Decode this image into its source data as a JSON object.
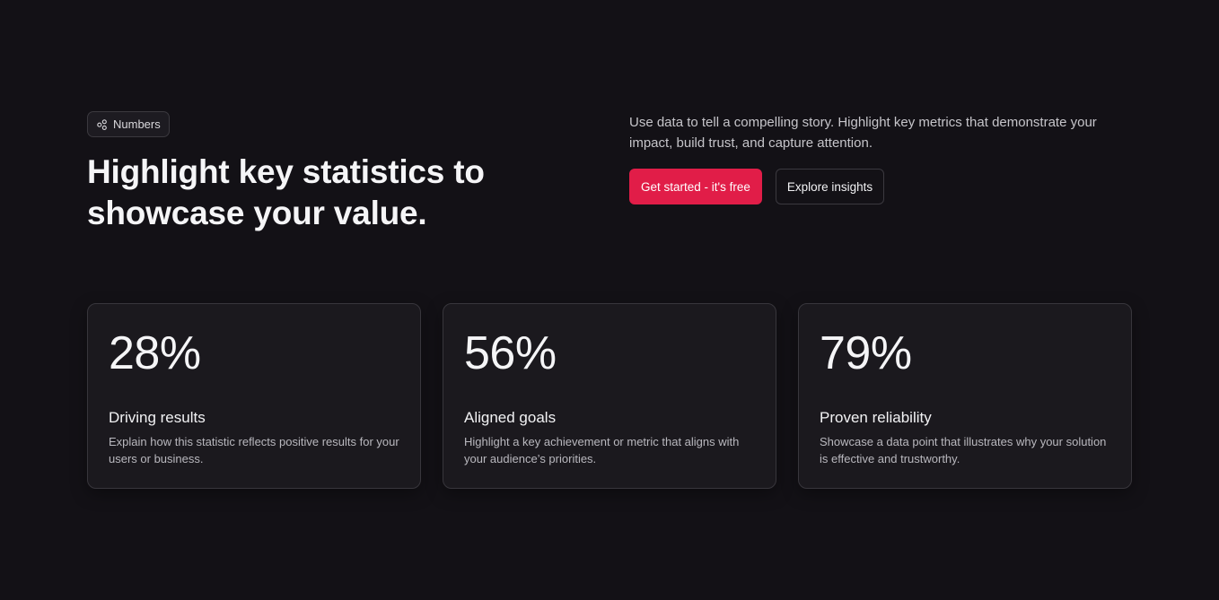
{
  "colors": {
    "background": "#131116",
    "accent": "#e11d48",
    "card_background": "#1b191e",
    "border": "#38363c"
  },
  "header": {
    "badge": {
      "icon": "share-nodes-icon",
      "label": "Numbers"
    },
    "title_line1": "Highlight key statistics to",
    "title_line2": "showcase your value.",
    "lead": "Use data to tell a compelling story. Highlight key metrics that demonstrate your impact, build trust, and capture attention.",
    "primary_button": "Get started - it's free",
    "secondary_button": "Explore insights"
  },
  "stats": [
    {
      "value": "28%",
      "title": "Driving results",
      "description": "Explain how this statistic reflects positive results for your users or business."
    },
    {
      "value": "56%",
      "title": "Aligned goals",
      "description": "Highlight a key achievement or metric that aligns with your audience’s priorities."
    },
    {
      "value": "79%",
      "title": "Proven reliability",
      "description": "Showcase a data point that illustrates why your solution is effective and trustworthy."
    }
  ]
}
